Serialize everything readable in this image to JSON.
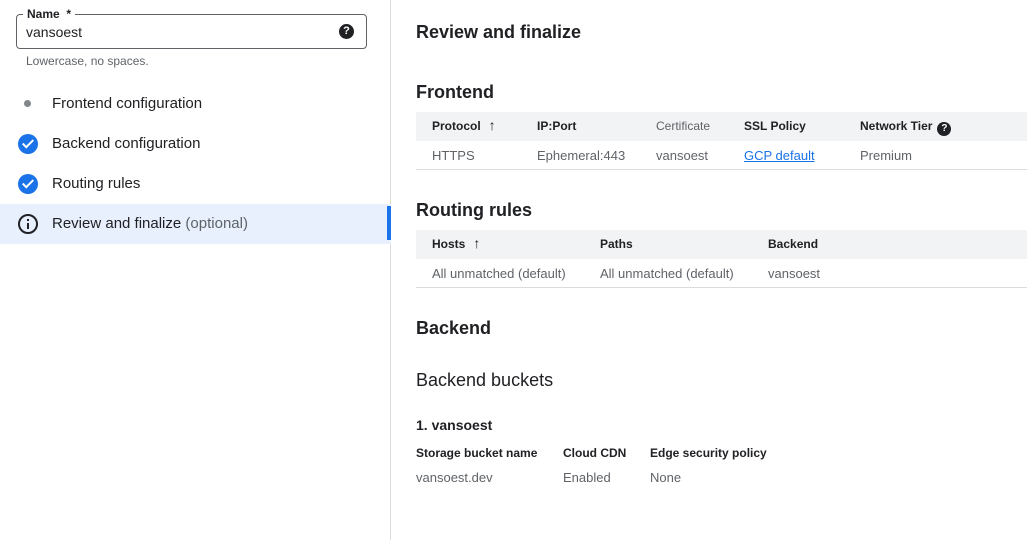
{
  "name_field": {
    "label": "Name",
    "required_mark": "*",
    "value": "vansoest",
    "help_icon": "help-icon",
    "hint": "Lowercase, no spaces."
  },
  "steps": [
    {
      "label": "Frontend configuration",
      "optional": "",
      "icon": "dot-icon"
    },
    {
      "label": "Backend configuration",
      "optional": "",
      "icon": "check-circle-icon"
    },
    {
      "label": "Routing rules",
      "optional": "",
      "icon": "check-circle-icon"
    },
    {
      "label": "Review and finalize",
      "optional": "(optional)",
      "icon": "info-icon"
    }
  ],
  "review": {
    "title": "Review and finalize",
    "frontend": {
      "heading": "Frontend",
      "columns": [
        "Protocol",
        "IP:Port",
        "Certificate",
        "SSL Policy",
        "Network Tier"
      ],
      "rows": [
        [
          "HTTPS",
          "Ephemeral:443",
          "vansoest",
          "GCP default",
          "Premium"
        ]
      ]
    },
    "routing": {
      "heading": "Routing rules",
      "columns": [
        "Hosts",
        "Paths",
        "Backend"
      ],
      "rows": [
        [
          "All unmatched (default)",
          "All unmatched (default)",
          "vansoest"
        ]
      ]
    },
    "backend": {
      "heading": "Backend",
      "subheading": "Backend buckets",
      "item_title": "1. vansoest",
      "fields": [
        {
          "label": "Storage bucket name",
          "value": "vansoest.dev"
        },
        {
          "label": "Cloud CDN",
          "value": "Enabled"
        },
        {
          "label": "Edge security policy",
          "value": "None"
        }
      ]
    }
  },
  "colors": {
    "accent": "#1a73e8",
    "active_bg": "#e8f0fe",
    "header_bg": "#f1f3f4",
    "divider": "#dadce0"
  }
}
